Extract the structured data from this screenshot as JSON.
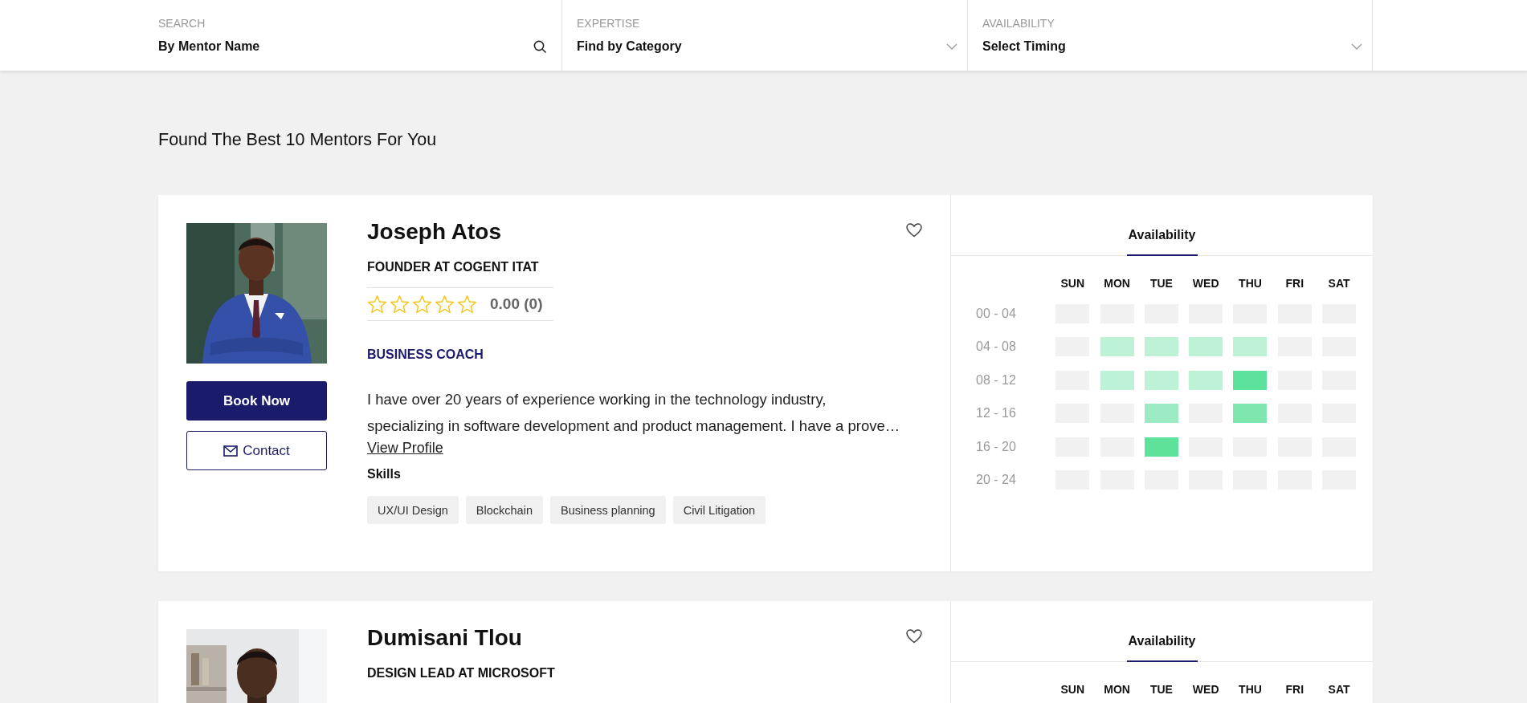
{
  "filters": [
    {
      "kind": "search",
      "label": "SEARCH",
      "value": "By Mentor Name"
    },
    {
      "kind": "select",
      "label": "EXPERTISE",
      "value": "Find by Category"
    },
    {
      "kind": "select",
      "label": "AVAILABILITY",
      "value": "Select Timing"
    }
  ],
  "results_heading": "Found The Best 10 Mentors For You",
  "mentors": [
    {
      "name": "Joseph Atos",
      "title": "FOUNDER AT COGENT ITAT",
      "stars": 0,
      "rating": "0.00 (0)",
      "category": "BUSINESS COACH",
      "description_lines": [
        "I have over 20 years of experience working in the technology industry,",
        "specializing in software development and product management. I have a prove…"
      ],
      "view_profile": "View Profile",
      "skills_label": "Skills",
      "skills": [
        "UX/UI Design",
        "Blockchain",
        "Business planning",
        "Civil Litigation"
      ],
      "book_button": "Book Now",
      "contact_button": "Contact",
      "availability": {
        "tab": "Availability",
        "days": [
          "SUN",
          "MON",
          "TUE",
          "WED",
          "THU",
          "FRI",
          "SAT"
        ],
        "slots": [
          {
            "time": "00 - 04",
            "cells": [
              {
                "color": "#f1f1f1"
              },
              {
                "color": "#f1f1f1"
              },
              {
                "color": "#f1f1f1"
              },
              {
                "color": "#f1f1f1"
              },
              {
                "color": "#f1f1f1"
              },
              {
                "color": "#f1f1f1"
              },
              {
                "color": "#f1f1f1"
              }
            ]
          },
          {
            "time": "04 - 08",
            "cells": [
              {
                "color": "#f1f1f1"
              },
              {
                "color": "#bdf2d6"
              },
              {
                "color": "#bdf2d6"
              },
              {
                "color": "#bdf2d6"
              },
              {
                "color": "#bdf2d6"
              },
              {
                "color": "#f1f1f1"
              },
              {
                "color": "#f1f1f1"
              }
            ]
          },
          {
            "time": "08 - 12",
            "cells": [
              {
                "color": "#f1f1f1"
              },
              {
                "color": "#bdf2d6"
              },
              {
                "color": "#bdf2d6"
              },
              {
                "color": "#bdf2d6"
              },
              {
                "color": "#5ce29a"
              },
              {
                "color": "#f1f1f1"
              },
              {
                "color": "#f1f1f1"
              }
            ]
          },
          {
            "time": "12 - 16",
            "cells": [
              {
                "color": "#f1f1f1"
              },
              {
                "color": "#f1f1f1"
              },
              {
                "color": "#9debc5"
              },
              {
                "color": "#f1f1f1"
              },
              {
                "color": "#7fe6b0"
              },
              {
                "color": "#f1f1f1"
              },
              {
                "color": "#f1f1f1"
              }
            ]
          },
          {
            "time": "16 - 20",
            "cells": [
              {
                "color": "#f1f1f1"
              },
              {
                "color": "#f1f1f1"
              },
              {
                "color": "#5ce29a"
              },
              {
                "color": "#f1f1f1"
              },
              {
                "color": "#f1f1f1"
              },
              {
                "color": "#f1f1f1"
              },
              {
                "color": "#f1f1f1"
              }
            ]
          },
          {
            "time": "20 - 24",
            "cells": [
              {
                "color": "#f1f1f1"
              },
              {
                "color": "#f1f1f1"
              },
              {
                "color": "#f1f1f1"
              },
              {
                "color": "#f1f1f1"
              },
              {
                "color": "#f1f1f1"
              },
              {
                "color": "#f1f1f1"
              },
              {
                "color": "#f1f1f1"
              }
            ]
          }
        ]
      }
    },
    {
      "name": "Dumisani Tlou",
      "title": "DESIGN LEAD AT MICROSOFT",
      "availability": {
        "tab": "Availability",
        "days": [
          "SUN",
          "MON",
          "TUE",
          "WED",
          "THU",
          "FRI",
          "SAT"
        ]
      }
    }
  ]
}
